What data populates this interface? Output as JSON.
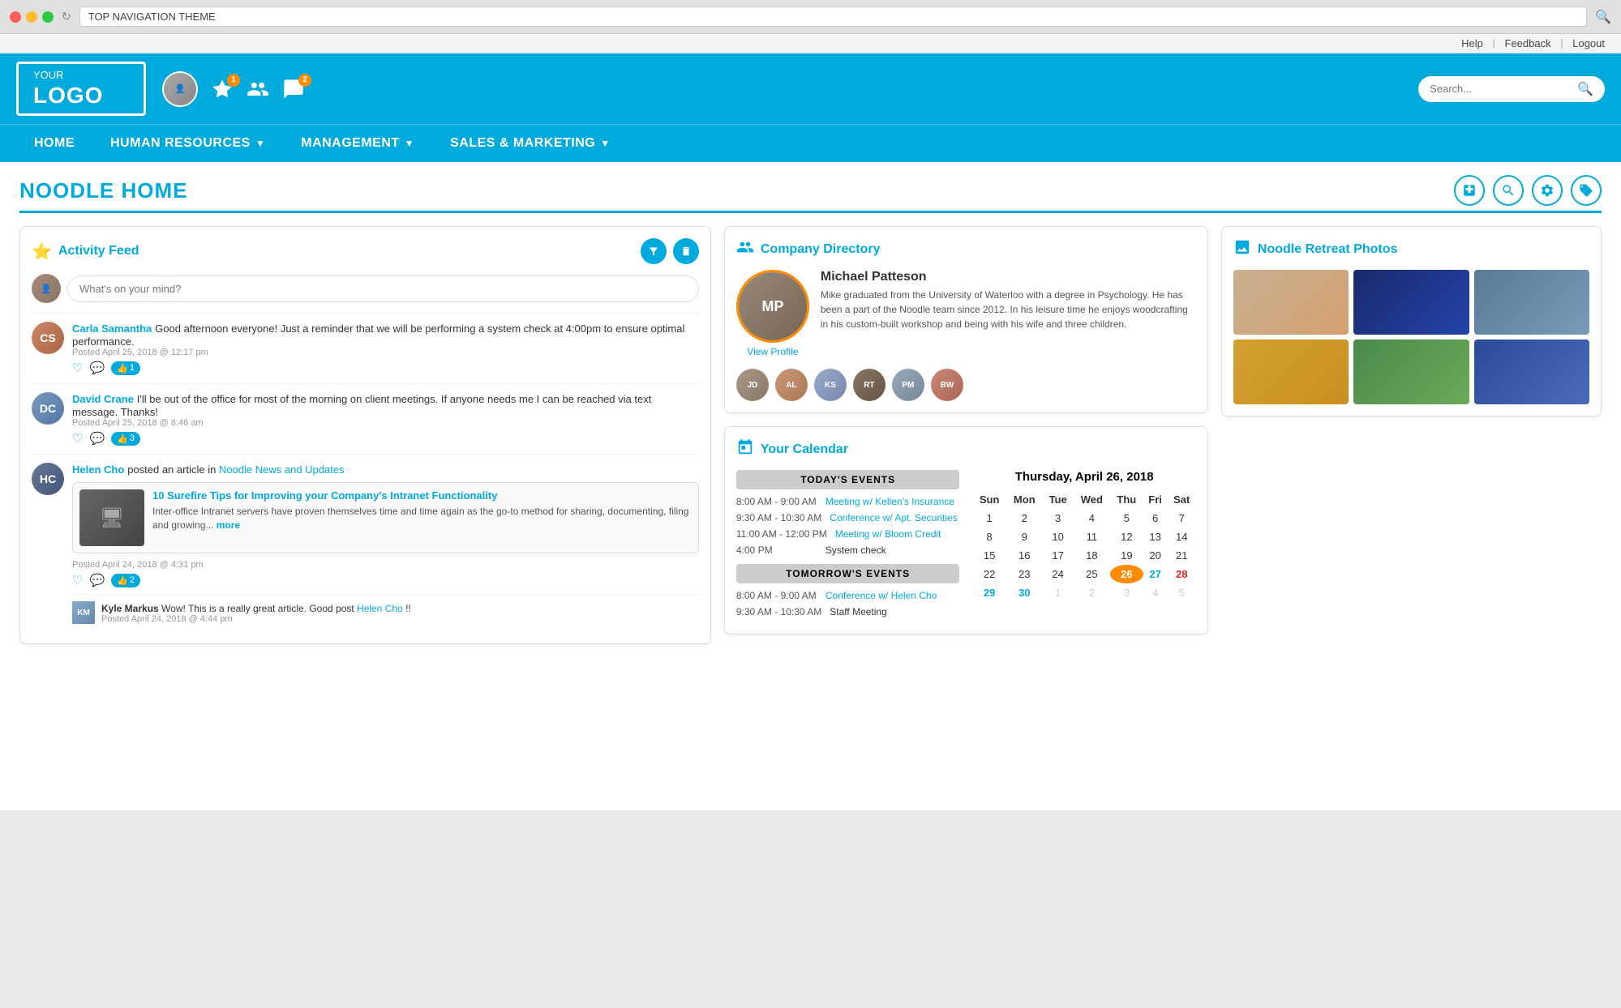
{
  "browser": {
    "url_text": "TOP NAVIGATION THEME",
    "reload_icon": "↻",
    "search_icon": "🔍"
  },
  "utility": {
    "help": "Help",
    "feedback": "Feedback",
    "logout": "Logout"
  },
  "header": {
    "logo_your": "YOUR",
    "logo_name": "LOGO",
    "search_placeholder": "Search...",
    "notifications_count": "1",
    "messages_count": "2"
  },
  "nav": {
    "items": [
      {
        "label": "HOME",
        "has_dropdown": false
      },
      {
        "label": "HUMAN RESOURCES",
        "has_dropdown": true
      },
      {
        "label": "MANAGEMENT",
        "has_dropdown": true
      },
      {
        "label": "SALES & MARKETING",
        "has_dropdown": true
      }
    ]
  },
  "page": {
    "title": "NOODLE HOME",
    "icons": [
      "📋",
      "🔍",
      "⚙",
      "🏷"
    ]
  },
  "activity_feed": {
    "title": "Activity Feed",
    "post_placeholder": "What's on your mind?",
    "posts": [
      {
        "author": "Carla Samantha",
        "text": "Good afternoon everyone! Just a reminder that we will be performing a system check at 4:00pm to ensure optimal performance.",
        "time": "Posted April 25, 2018 @ 12:17 pm",
        "likes": "1",
        "avatar_initials": "CS"
      },
      {
        "author": "David Crane",
        "text": "I'll be out of the office for most of the morning on client meetings. If anyone needs me I can be reached via text message. Thanks!",
        "time": "Posted April 25, 2018 @ 8:46 am",
        "likes": "3",
        "avatar_initials": "DC"
      },
      {
        "author": "Helen Cho",
        "posted_in_text": "posted an article in",
        "channel": "Noodle News and Updates",
        "time": "Posted April 24, 2018 @ 4:31 pm",
        "likes": "2",
        "avatar_initials": "HC",
        "article": {
          "title": "10 Surefire Tips for Improving your Company's Intranet Functionality",
          "excerpt": "Inter-office Intranet servers have proven themselves time and time again as the go-to method for sharing, documenting, filing and growing...",
          "more": "more"
        },
        "comment": {
          "commenter": "Kyle Markus",
          "text": "Wow! This is a really great article. Good post ",
          "mention": "Helen Cho",
          "suffix": "!!",
          "time": "Posted April 24, 2018 @ 4:44 pm",
          "avatar_initials": "KM"
        }
      }
    ]
  },
  "company_directory": {
    "title": "Company Directory",
    "featured": {
      "name": "Michael Patteson",
      "bio": "Mike graduated from the University of Waterloo with a degree in Psychology. He has been a part of the Noodle team since 2012. In his leisure time he enjoys woodcrafting in his custom-built workshop and being with his wife and three children.",
      "view_profile": "View Profile",
      "avatar_initials": "MP"
    },
    "other_avatars": [
      "JD",
      "AL",
      "KS",
      "RT",
      "PM",
      "BW"
    ]
  },
  "photos": {
    "title": "Noodle Retreat Photos"
  },
  "calendar": {
    "title": "Your Calendar",
    "date_display": "Thursday, April 26, 2018",
    "today_events_header": "TODAY'S EVENTS",
    "tomorrow_events_header": "TOMORROW'S EVENTS",
    "today_events": [
      {
        "time": "8:00 AM - 9:00 AM",
        "name": "Meeting w/ Kellen's Insurance",
        "linked": true
      },
      {
        "time": "9:30 AM - 10:30 AM",
        "name": "Conference w/ Apt. Securities",
        "linked": true
      },
      {
        "time": "11:00 AM - 12:00 PM",
        "name": "Meeting w/ Bloom Credit",
        "linked": true
      },
      {
        "time": "4:00 PM",
        "name": "System check",
        "linked": false
      }
    ],
    "tomorrow_events": [
      {
        "time": "8:00 AM - 9:00 AM",
        "name": "Conference w/ Helen Cho",
        "linked": true
      },
      {
        "time": "9:30 AM - 10:30 AM",
        "name": "Staff Meeting",
        "linked": false
      }
    ],
    "calendar": {
      "headers": [
        "Sun",
        "Mon",
        "Tue",
        "Wed",
        "Thu",
        "Fri",
        "Sat"
      ],
      "weeks": [
        [
          "1",
          "2",
          "3",
          "4",
          "5",
          "6",
          "7"
        ],
        [
          "8",
          "9",
          "10",
          "11",
          "12",
          "13",
          "14"
        ],
        [
          "15",
          "16",
          "17",
          "18",
          "19",
          "20",
          "21"
        ],
        [
          "22",
          "23",
          "24",
          "25",
          "26",
          "27",
          "28"
        ],
        [
          "29",
          "30",
          "1",
          "2",
          "3",
          "4",
          "5"
        ]
      ],
      "today_cell": "26",
      "blue_cells": [
        "27",
        "30"
      ],
      "red_cells": [
        "28"
      ],
      "other_month_last_row": [
        "1",
        "2",
        "3",
        "4",
        "5"
      ]
    }
  }
}
